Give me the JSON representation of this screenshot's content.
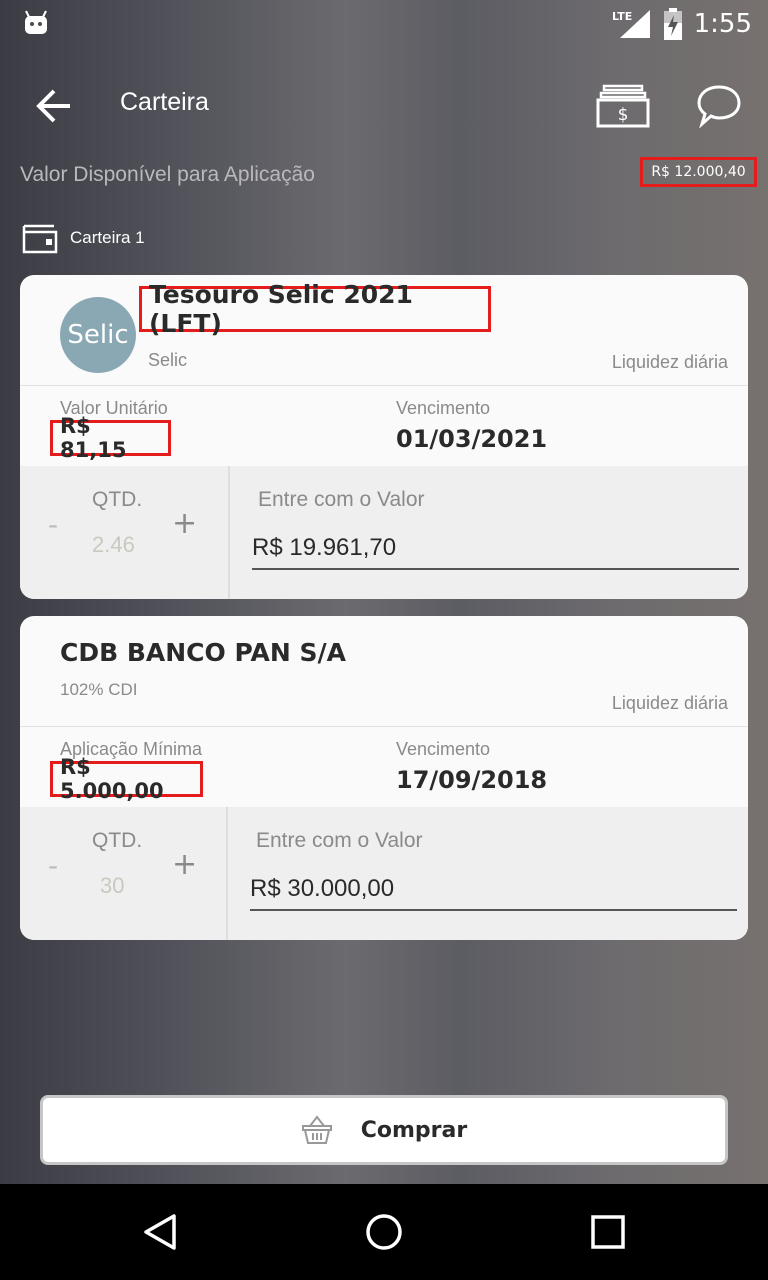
{
  "status_bar": {
    "time": "1:55",
    "network": "LTE",
    "icons": [
      "android-icon",
      "lte-signal-icon",
      "battery-charging-icon"
    ]
  },
  "app_bar": {
    "title": "Carteira",
    "icons": [
      "back-arrow-icon",
      "cash-icon",
      "chat-bubble-icon"
    ]
  },
  "available": {
    "label": "Valor Disponível para Aplicação",
    "value": "R$ 12.000,40"
  },
  "wallet": {
    "label": "Carteira 1"
  },
  "products": [
    {
      "logo_text": "Selic",
      "title": "Tesouro Selic 2021 (LFT)",
      "subtitle": "Selic",
      "liquidity": "Liquidez diária",
      "unit_label": "Valor Unitário",
      "unit_value": "R$ 81,15",
      "due_label": "Vencimento",
      "due_value": "01/03/2021",
      "qty_label": "QTD.",
      "qty_value": "2.46",
      "minus": "-",
      "plus": "+",
      "value_label": "Entre com o Valor",
      "value_input": "R$ 19.961,70"
    },
    {
      "title": "CDB  BANCO PAN S/A",
      "subtitle": "102% CDI",
      "liquidity": "Liquidez diária",
      "unit_label": "Aplicação Mínima",
      "unit_value": "R$ 5.000,00",
      "due_label": "Vencimento",
      "due_value": "17/09/2018",
      "qty_label": "QTD.",
      "qty_value": "30",
      "minus": "-",
      "plus": "+",
      "value_label": "Entre com o Valor",
      "value_input": "R$ 30.000,00"
    }
  ],
  "buy_button": {
    "label": "Comprar",
    "icon": "basket-icon"
  },
  "nav": {
    "icons": [
      "nav-back-icon",
      "nav-home-icon",
      "nav-recents-icon"
    ]
  },
  "colors": {
    "highlight": "#e41c1c",
    "card_bg": "#fafafa",
    "nav_bg": "#000000"
  }
}
